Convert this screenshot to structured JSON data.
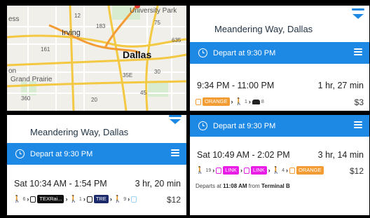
{
  "map": {
    "labels": {
      "university_park": "University Park",
      "irving": "Irving",
      "dallas": "Dallas",
      "grand_prairie": "Grand Prairie",
      "ess": "ess",
      "on": "on",
      "r183": "183",
      "r12": "12",
      "r161": "161",
      "r360": "360",
      "r30": "30",
      "r20": "20",
      "r45": "45",
      "r35e": "35E",
      "r75": "75",
      "r635": "635"
    }
  },
  "panels": {
    "top_right": {
      "destination": "Meandering Way, Dallas",
      "depart": "Depart at 9:30 PM",
      "trip": {
        "time": "9:34 PM - 11:00 PM",
        "duration": "1 hr, 27 min",
        "price": "$3",
        "route": {
          "chip1": "ORANGE",
          "walk_min": "1",
          "car_min": "8"
        }
      }
    },
    "bottom_left": {
      "destination": "Meandering Way, Dallas",
      "depart": "Depart at 9:30 PM",
      "trip": {
        "time": "Sat 10:34 AM - 1:54 PM",
        "duration": "3 hr, 20 min",
        "price": "$12",
        "route": {
          "walk1": "6",
          "chip1": "TEXRai...",
          "walk2": "1",
          "chip2": "TRE",
          "walk3": "9"
        }
      }
    },
    "bottom_right": {
      "depart": "Depart at 9:30 PM",
      "trip": {
        "time": "Sat 10:49 AM - 2:02 PM",
        "duration": "3 hr, 14 min",
        "price": "$12",
        "route": {
          "walk1": "19",
          "chip1": "LINK",
          "chip2": "LINK",
          "walk2": "4",
          "chip3": "ORANGE"
        },
        "departs_prefix": "Departs at ",
        "departs_time": "11:08 AM",
        "departs_mid": " from ",
        "departs_place": "Terminal B"
      }
    }
  }
}
